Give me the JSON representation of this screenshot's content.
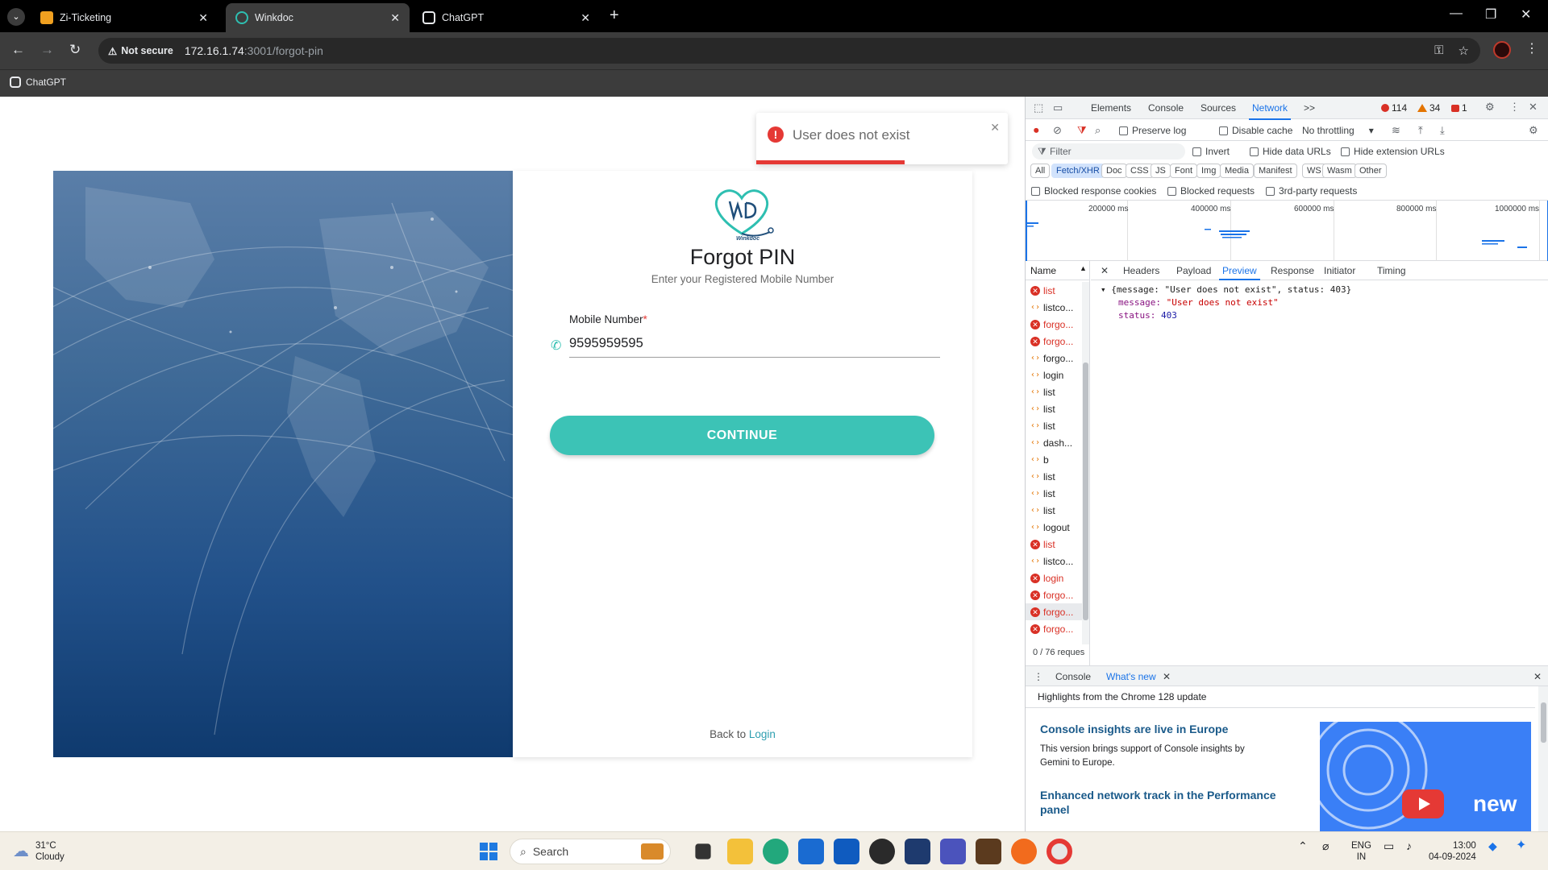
{
  "browser": {
    "tabs": [
      {
        "title": "Zi-Ticketing",
        "active": false
      },
      {
        "title": "Winkdoc",
        "active": true
      },
      {
        "title": "ChatGPT",
        "active": false
      }
    ],
    "address": {
      "security": "Not secure",
      "host": "172.16.1.74",
      "path": ":3001/forgot-pin"
    },
    "bookmark": "ChatGPT"
  },
  "page": {
    "toast": {
      "message": "User does not exist"
    },
    "logo_text": "Winkdoc",
    "title": "Forgot PIN",
    "subtitle": "Enter your Registered Mobile Number",
    "mobile_label": "Mobile Number",
    "required_mark": "*",
    "mobile_value": "9595959595",
    "continue_label": "CONTINUE",
    "back_text": "Back to",
    "login_link": "Login"
  },
  "devtools": {
    "tabs": [
      "Elements",
      "Console",
      "Sources",
      "Network"
    ],
    "active_tab": "Network",
    "more": ">>",
    "errors": "114",
    "warnings": "34",
    "issues": "1",
    "options": {
      "preserve_log": "Preserve log",
      "disable_cache": "Disable cache",
      "throttling": "No throttling"
    },
    "filter_placeholder": "Filter",
    "filter_opts": {
      "invert": "Invert",
      "hide_data": "Hide data URLs",
      "hide_ext": "Hide extension URLs"
    },
    "type_filters": [
      "All",
      "Fetch/XHR",
      "Doc",
      "CSS",
      "JS",
      "Font",
      "Img",
      "Media",
      "Manifest",
      "WS",
      "Wasm",
      "Other"
    ],
    "block_opts": {
      "blocked_cookies": "Blocked response cookies",
      "blocked_requests": "Blocked requests",
      "third_party": "3rd-party requests"
    },
    "overview_ticks": [
      "200000 ms",
      "400000 ms",
      "600000 ms",
      "800000 ms",
      "1000000 ms"
    ],
    "name_header": "Name",
    "requests": [
      {
        "name": "list",
        "error": true
      },
      {
        "name": "listco...",
        "error": false
      },
      {
        "name": "forgo...",
        "error": true
      },
      {
        "name": "forgo...",
        "error": true
      },
      {
        "name": "forgo...",
        "error": false
      },
      {
        "name": "login",
        "error": false
      },
      {
        "name": "list",
        "error": false
      },
      {
        "name": "list",
        "error": false
      },
      {
        "name": "list",
        "error": false
      },
      {
        "name": "dash...",
        "error": false
      },
      {
        "name": "b",
        "error": false
      },
      {
        "name": "list",
        "error": false
      },
      {
        "name": "list",
        "error": false
      },
      {
        "name": "list",
        "error": false
      },
      {
        "name": "logout",
        "error": false
      },
      {
        "name": "list",
        "error": true
      },
      {
        "name": "listco...",
        "error": false
      },
      {
        "name": "login",
        "error": true
      },
      {
        "name": "forgo...",
        "error": true
      },
      {
        "name": "forgo...",
        "error": true
      },
      {
        "name": "forgo...",
        "error": true
      }
    ],
    "request_count": "0 / 76 reques",
    "detail_tabs": [
      "Headers",
      "Payload",
      "Preview",
      "Response",
      "Initiator",
      "Timing"
    ],
    "active_detail": "Preview",
    "preview": {
      "summary": "{message: \"User does not exist\", status: 403}",
      "message_key": "message:",
      "message_val": "\"User does not exist\"",
      "status_key": "status:",
      "status_val": "403"
    },
    "drawer": {
      "tabs": [
        "Console",
        "What's new"
      ],
      "header": "Highlights from the Chrome 128 update",
      "item1_title": "Console insights are live in Europe",
      "item1_text": "This version brings support of Console insights by Gemini to Europe.",
      "item2_title": "Enhanced network track in the Performance panel",
      "video_label": "new"
    }
  },
  "taskbar": {
    "temp": "31°C",
    "condition": "Cloudy",
    "search": "Search",
    "lang1": "ENG",
    "lang2": "IN",
    "time": "13:00",
    "date": "04-09-2024"
  }
}
